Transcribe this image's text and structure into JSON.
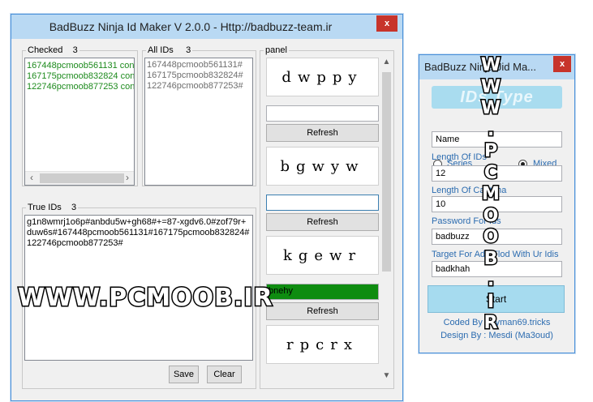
{
  "main_window": {
    "title": "BadBuzz Ninja Id Maker V 2.0.0 - Http://badbuzz-team.ir",
    "close": "x",
    "checked": {
      "legend": "Checked",
      "count": "3",
      "items": [
        "167448pcmoob561131 con",
        "167175pcmoob832824 con",
        "122746pcmoob877253 con"
      ]
    },
    "all_ids": {
      "legend": "All IDs",
      "count": "3",
      "items": [
        "167448pcmoob561131#",
        "167175pcmoob832824#",
        "122746pcmoob877253#"
      ]
    },
    "true_ids": {
      "legend": "True IDs",
      "count": "3",
      "text": "g1n8wmrj1o6p#anbdu5w+gh68#+=87-xgdv6.0#zof79r+duw6s#167448pcmoob561131#167175pcmoob832824#122746pcmoob877253#"
    },
    "save_label": "Save",
    "clear_label": "Clear",
    "panel": {
      "legend": "panel",
      "captchas": [
        {
          "text": "dwppy",
          "input": "",
          "refresh": "Refresh"
        },
        {
          "text": "bgwyw",
          "input": "",
          "refresh": "Refresh"
        },
        {
          "text": "kgewr",
          "input": "bnehy",
          "refresh": "Refresh"
        },
        {
          "text": "rpcrx"
        }
      ]
    }
  },
  "side_window": {
    "title": "BadBuzz Ninja Jid Ma...",
    "close": "x",
    "logo_text": "IDs Type",
    "series_label": "Series",
    "mixed_label": "Mixed",
    "selected_type": "Mixed",
    "name_value": "Name",
    "length_ids_label": "Length Of IDs",
    "length_ids_value": "12",
    "length_captcha_label": "Length Of Captcha",
    "length_captcha_value": "10",
    "password_label": "Password For Ids",
    "password_value": "badbuzz",
    "target_label": "Target For Add Flod With Ur Idis",
    "target_value": "badkhah",
    "start_label": "Start",
    "coded_by": "Coded By : Ayman69.tricks",
    "design_by": "Design By : Mesdi (Ma3oud)"
  },
  "watermark_horizontal": "WWW.PCMOOB.IR",
  "watermark_vertical": [
    "W",
    "W",
    "W",
    ".",
    "P",
    "C",
    "M",
    "O",
    "O",
    "B",
    ".",
    "I",
    "R"
  ]
}
